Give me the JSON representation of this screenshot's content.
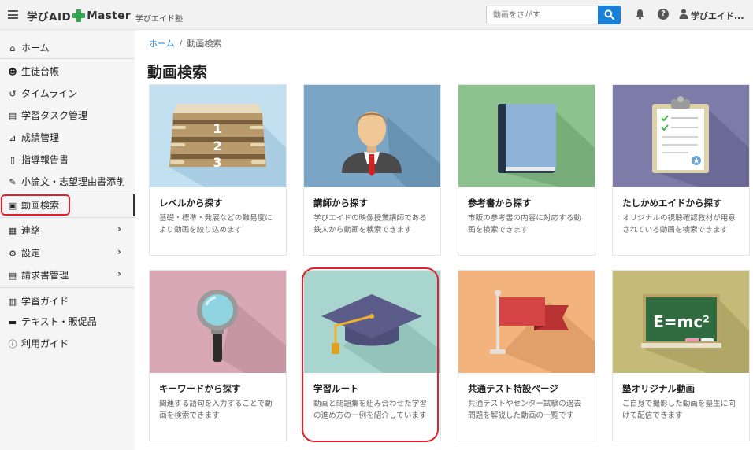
{
  "header": {
    "brand": "学びAID",
    "brand_suffix": "Master",
    "brand_sub": "学びエイド塾",
    "search_placeholder": "動画をさがす",
    "help_glyph": "?",
    "user_name": "学びエイド..."
  },
  "sidebar": {
    "items": [
      {
        "label": "ホーム",
        "icon": "home-icon"
      },
      {
        "label": "生徒台帳",
        "icon": "users-icon"
      },
      {
        "label": "タイムライン",
        "icon": "history-icon"
      },
      {
        "label": "学習タスク管理",
        "icon": "clipboard-icon"
      },
      {
        "label": "成績管理",
        "icon": "chart-icon"
      },
      {
        "label": "指導報告書",
        "icon": "file-icon"
      },
      {
        "label": "小論文・志望理由書添削",
        "icon": "pen-icon"
      },
      {
        "label": "動画検索",
        "icon": "video-search-icon"
      },
      {
        "label": "連絡",
        "icon": "message-icon"
      },
      {
        "label": "設定",
        "icon": "settings-icon"
      },
      {
        "label": "請求書管理",
        "icon": "invoice-icon"
      },
      {
        "label": "学習ガイド",
        "icon": "book-icon"
      },
      {
        "label": "テキスト・販促品",
        "icon": "cart-icon"
      },
      {
        "label": "利用ガイド",
        "icon": "info-icon"
      }
    ],
    "chevron": "›"
  },
  "breadcrumb": {
    "home": "ホーム",
    "separator": "/",
    "current": "動画検索"
  },
  "page_title": "動画検索",
  "cards": [
    {
      "title": "レベルから探す",
      "desc": "基礎・標準・発展などの難易度により動画を絞り込めます",
      "bg": "#c3e0f1"
    },
    {
      "title": "講師から探す",
      "desc": "学びエイドの映像授業講師である鉄人から動画を検索できます",
      "bg": "#7ba5c4"
    },
    {
      "title": "参考書から探す",
      "desc": "市販の参考書の内容に対応する動画を検索できます",
      "bg": "#8dc28e"
    },
    {
      "title": "たしかめエイドから探す",
      "desc": "オリジナルの視聴確認教材が用意されている動画を検索できます",
      "bg": "#7d7ba8"
    },
    {
      "title": "キーワードから探す",
      "desc": "関連する語句を入力することで動画を検索できます",
      "bg": "#d8a8b6"
    },
    {
      "title": "学習ルート",
      "desc": "動画と問題集を組み合わせた学習の進め方の一例を紹介しています",
      "bg": "#a8d6cf"
    },
    {
      "title": "共通テスト特設ページ",
      "desc": "共通テストやセンター試験の過去問題を解説した動画の一覧です",
      "bg": "#f2b47c"
    },
    {
      "title": "塾オリジナル動画",
      "desc": "ご自身で撮影した動画を塾生に向けて配信できます",
      "bg": "#c4bb79"
    }
  ],
  "art_text": {
    "level_numbers": [
      "1",
      "2",
      "3"
    ],
    "formula": "E=mc²"
  }
}
